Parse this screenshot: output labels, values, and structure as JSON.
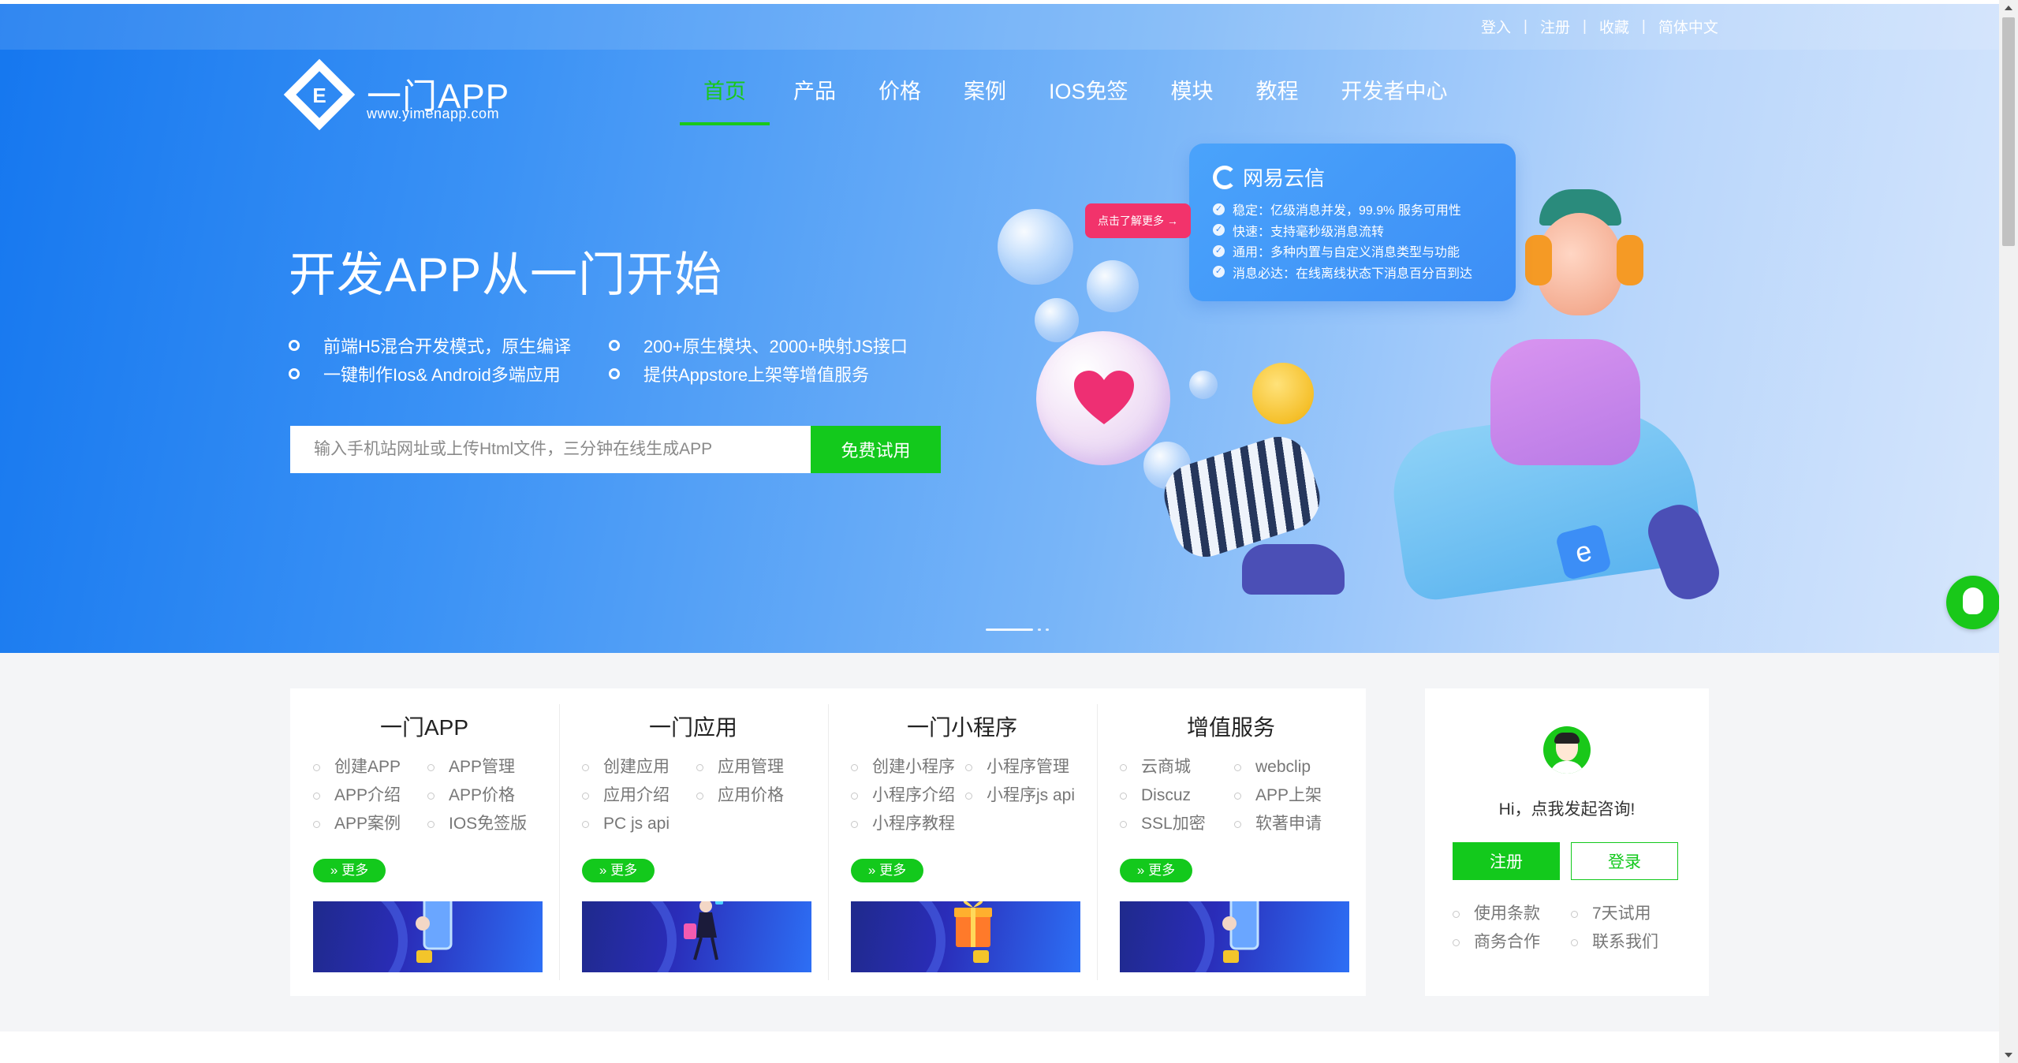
{
  "topbar": {
    "login": "登入",
    "register": "注册",
    "favorite": "收藏",
    "language": "简体中文",
    "sep": "|"
  },
  "brand": {
    "name": "一门APP",
    "url": "www.yimenapp.com",
    "mark": "E"
  },
  "nav": {
    "items": [
      {
        "label": "首页",
        "active": true
      },
      {
        "label": "产品"
      },
      {
        "label": "价格"
      },
      {
        "label": "案例"
      },
      {
        "label": "IOS免签"
      },
      {
        "label": "模块"
      },
      {
        "label": "教程"
      },
      {
        "label": "开发者中心"
      }
    ],
    "accent_color": "#19c819"
  },
  "hero": {
    "title": "开发APP从一门开始",
    "features": [
      "前端H5混合开发模式，原生编译",
      "200+原生模块、2000+映射JS接口",
      "一键制作Ios& Android多端应用",
      "提供Appstore上架等增值服务"
    ],
    "search_placeholder": "输入手机站网址或上传Html文件，三分钟在线生成APP",
    "try_button": "免费试用"
  },
  "promo": {
    "brand": "网易云信",
    "more_tag": "点击了解更多 →",
    "lines": [
      "稳定：亿级消息并发，99.9% 服务可用性",
      "快速：支持毫秒级消息流转",
      "通用：多种内置与自定义消息类型与功能",
      "消息必达：在线离线状态下消息百分百到达"
    ],
    "badge_letter": "e"
  },
  "services": [
    {
      "title": "一门APP",
      "links": [
        "创建APP",
        "APP管理",
        "APP介绍",
        "APP价格",
        "APP案例",
        "IOS免签版"
      ],
      "more": "» 更多"
    },
    {
      "title": "一门应用",
      "links": [
        "创建应用",
        "应用管理",
        "应用介绍",
        "应用价格",
        "PC js api"
      ],
      "more": "» 更多"
    },
    {
      "title": "一门小程序",
      "links": [
        "创建小程序",
        "小程序管理",
        "小程序介绍",
        "小程序js api",
        "小程序教程"
      ],
      "more": "» 更多"
    },
    {
      "title": "增值服务",
      "links": [
        "云商城",
        "webclip",
        "Discuz",
        "APP上架",
        "SSL加密",
        "软著申请"
      ],
      "more": "» 更多"
    }
  ],
  "consult": {
    "greeting": "Hi，点我发起咨询!",
    "register": "注册",
    "login": "登录",
    "links": [
      "使用条款",
      "7天试用",
      "商务合作",
      "联系我们"
    ]
  },
  "colors": {
    "green": "#13c91c",
    "hero_blue": "#1577ef",
    "promo_pink": "#f2336b"
  }
}
